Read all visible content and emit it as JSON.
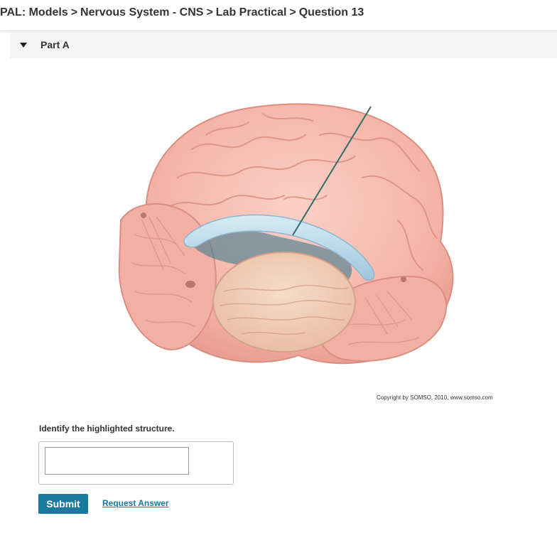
{
  "breadcrumb": {
    "items": [
      "PAL: Models",
      "Nervous System - CNS",
      "Lab Practical",
      "Question 13"
    ],
    "separator": ">"
  },
  "part": {
    "label": "Part A",
    "expanded": true
  },
  "figure": {
    "subject": "brain model with highlighted structure",
    "copyright": "Copyright by SOMSO, 2010, www.somso.com"
  },
  "question": {
    "prompt": "Identify the highlighted structure.",
    "answer_value": "",
    "answer_placeholder": ""
  },
  "actions": {
    "submit_label": "Submit",
    "request_answer_label": "Request Answer"
  },
  "colors": {
    "accent": "#197a9e",
    "header_bg": "#f5f5f5",
    "brain_pink": "#f4b5aa",
    "highlight_blue": "#b9d8ea"
  },
  "icons": {
    "part_toggle": "caret-down-icon"
  }
}
